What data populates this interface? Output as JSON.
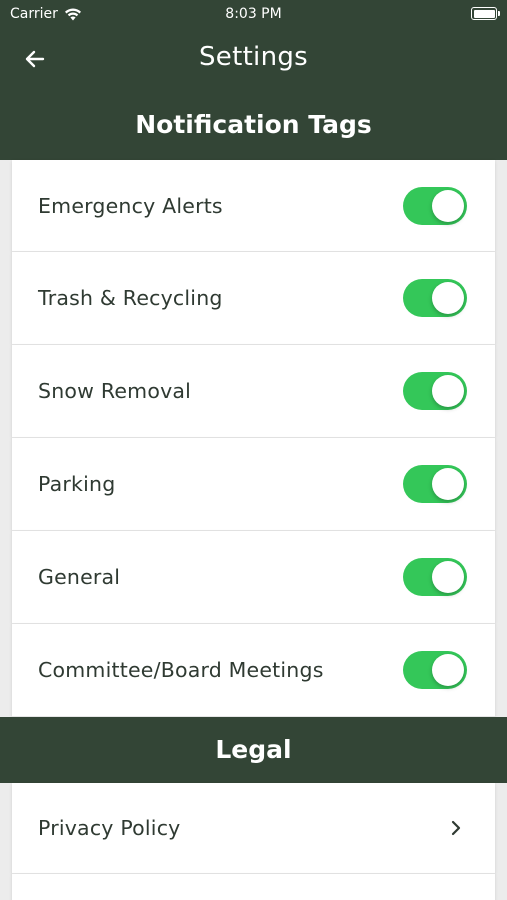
{
  "status": {
    "carrier": "Carrier",
    "time": "8:03 PM"
  },
  "nav": {
    "title": "Settings",
    "back_icon": "arrow-left-icon"
  },
  "notifications": {
    "header": "Notification Tags",
    "items": [
      {
        "label": "Emergency Alerts",
        "enabled": true
      },
      {
        "label": "Trash & Recycling",
        "enabled": true
      },
      {
        "label": "Snow Removal",
        "enabled": true
      },
      {
        "label": "Parking",
        "enabled": true
      },
      {
        "label": "General",
        "enabled": true
      },
      {
        "label": "Committee/Board Meetings",
        "enabled": true
      }
    ]
  },
  "legal": {
    "header": "Legal",
    "items": [
      {
        "label": "Privacy Policy",
        "icon": "chevron-right-icon"
      }
    ]
  },
  "colors": {
    "header_bg": "#334536",
    "toggle_on": "#34c759",
    "text": "#2f3a32"
  }
}
